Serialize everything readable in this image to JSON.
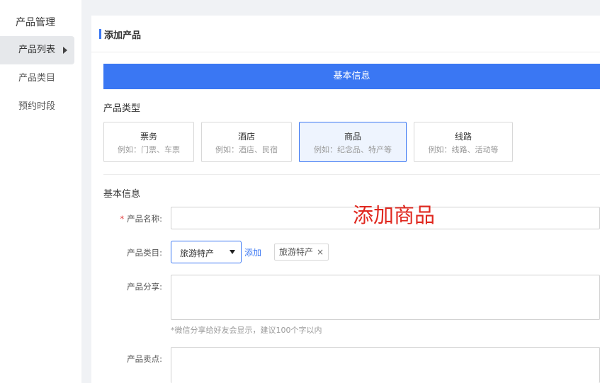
{
  "sidebar": {
    "title": "产品管理",
    "items": [
      {
        "label": "产品列表",
        "active": true
      },
      {
        "label": "产品类目",
        "active": false
      },
      {
        "label": "预约时段",
        "active": false
      }
    ]
  },
  "panel": {
    "title": "添加产品",
    "section_title": "基本信息",
    "product_type_label": "产品类型",
    "types": [
      {
        "name": "票务",
        "hint": "例如：门票、车票",
        "selected": false
      },
      {
        "name": "酒店",
        "hint": "例如：酒店、民宿",
        "selected": false
      },
      {
        "name": "商品",
        "hint": "例如：纪念品、特产等",
        "selected": true
      },
      {
        "name": "线路",
        "hint": "例如：线路、活动等",
        "selected": false
      }
    ],
    "basic_info_label": "基本信息",
    "fields": {
      "name_label": "产品名称:",
      "name_required": "*",
      "name_value": "",
      "category_label": "产品类目:",
      "category_value": "旅游特产",
      "category_add": "添加",
      "category_tag": "旅游特产",
      "category_tag_close": "×",
      "share_label": "产品分享:",
      "share_value": "",
      "share_hint": "*微信分享给好友会显示，建议100个字以内",
      "selling_label": "产品卖点:",
      "selling_value": ""
    }
  },
  "overlay_text": "添加商品",
  "colors": {
    "accent": "#3a77f3",
    "required": "#e23b3b",
    "overlay": "#e0281f"
  }
}
